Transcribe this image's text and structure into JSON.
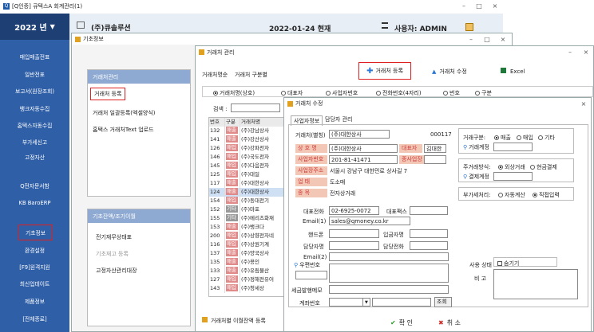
{
  "main": {
    "app_title": "[Q인증] 큐텍스A  회계관리(1)",
    "year": "2022 년",
    "company": "(주)큐솔루션",
    "date": "2022-01-24 현재",
    "user": "사용자: ADMIN"
  },
  "sidebar": {
    "items": [
      "매입매출전표",
      "일반전표",
      "보고서(원장조회)",
      "뱅크자동수집",
      "홈택스자동수집",
      "부가세신고",
      "고정자산",
      "Q전자문서함",
      "KB BaroERP",
      "기초정보",
      "환경설정",
      "[F9]원격지원",
      "최신업데이트",
      "제품정보",
      "[전체종료]"
    ]
  },
  "basic": {
    "title": "기초정보",
    "group1_title": "거래처관리",
    "group1_items": [
      "거래처 등록",
      "거래처 일괄등록(엑셀양식)",
      "홈택스 거래처Text 업로드"
    ],
    "group2_title": "기초잔액/조기이월",
    "group2_items": [
      "전기재무상태표",
      "기초재고 등록",
      "고정자산관리대장"
    ]
  },
  "client_mgmt": {
    "title": "거래처 관리",
    "tabs": [
      "거래처명순",
      "거래처 구분별"
    ],
    "register_btn": "거래처 등록",
    "edit_btn": "거래처 수정",
    "excel_btn": "Excel",
    "radios": [
      "거래처명(상호)",
      "대표자",
      "사업자번호",
      "전화번호(4자리)",
      "번호",
      "구분"
    ],
    "search_label": "검색 :",
    "col_no": "번호",
    "col_type": "구분",
    "col_name": "거래처명",
    "rows": [
      [
        "132",
        "매출",
        "(주)강남상사"
      ],
      [
        "141",
        "매출",
        "(주)강산상사"
      ],
      [
        "126",
        "매입",
        "(주)강파전자"
      ],
      [
        "146",
        "매입",
        "(주)국도전자"
      ],
      [
        "145",
        "매입",
        "(주)다음전자"
      ],
      [
        "125",
        "매입",
        "(주)대일"
      ],
      [
        "117",
        "매출",
        "(주)대한상사"
      ],
      [
        "124",
        "매출",
        "(주)대한상사"
      ],
      [
        "154",
        "매입",
        "(주)동대전기"
      ],
      [
        "152",
        "기타",
        "(주)마포"
      ],
      [
        "155",
        "기타",
        "(주)메리츠화재"
      ],
      [
        "153",
        "매출",
        "(주)뱅크다"
      ],
      [
        "200",
        "매입",
        "(주)상향전자네"
      ],
      [
        "116",
        "매입",
        "(주)상원기계"
      ],
      [
        "137",
        "매출",
        "(주)양국상사"
      ],
      [
        "135",
        "매출",
        "(주)용인"
      ],
      [
        "133",
        "매출",
        "(주)유림물산"
      ],
      [
        "127",
        "매입",
        "(주)정해전유어"
      ],
      [
        "143",
        "매입",
        "(주)청세상"
      ]
    ],
    "bottom_tab": "거래처별 이월잔액 등록"
  },
  "dialog": {
    "title": "거래처 수정",
    "tabs": [
      "사업자정보",
      "담당자 관리"
    ],
    "name_label": "거래처(별칭)",
    "name_value": "(주)대한상사",
    "code": "000117",
    "lbl_sangho": "상 호 명",
    "sangho": "(주)대한상사",
    "lbl_rep": "대표자",
    "rep": "김대한",
    "lbl_bizno": "사업자번호",
    "bizno": "201-81-41471",
    "lbl_jong": "종사업장",
    "lbl_addr": "사업장주소",
    "addr": "서울시 강남구 대한민로 상사길 7",
    "lbl_uptae": "업    태",
    "uptae": "도소매",
    "lbl_jongmok": "종    목",
    "jongmok": "전자상거래",
    "lbl_tel": "대표전화",
    "tel": "02-6925-0072",
    "lbl_fax": "대표팩스",
    "lbl_email1": "Email(1)",
    "email1": "sales@qmoney.co.kr",
    "lbl_phone": "핸드폰",
    "lbl_dept": "입금자명",
    "lbl_mgr": "담당자명",
    "lbl_mgrtel": "담당전화",
    "lbl_email2": "Email(2)",
    "lbl_zip": "우편번호",
    "lbl_taxnote": "세금발행메모",
    "lbl_account": "계좌번호",
    "search_btn": "조회",
    "deal_label": "거래구분:",
    "deal_opts": [
      "매출",
      "매입",
      "기타"
    ],
    "deal_acct": "거래계정",
    "pay_label": "주거래방식:",
    "pay_opts": [
      "외상거래",
      "현금결제"
    ],
    "pay_acct": "결제계정",
    "vat_label": "부가세처리:",
    "vat_opts": [
      "자동계산",
      "직접입력"
    ],
    "status_label": "사용 상태",
    "hide_label": "숨기기",
    "memo_label": "비    고",
    "ok_btn": "확 인",
    "cancel_btn": "취 소"
  }
}
